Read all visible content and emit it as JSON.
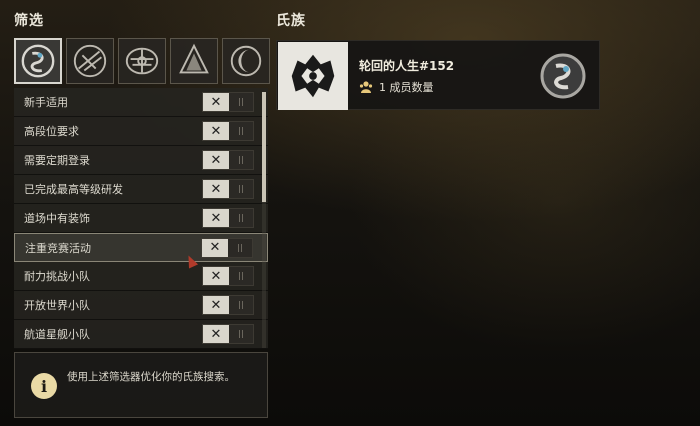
{
  "filter_panel": {
    "title": "筛选",
    "icons": [
      {
        "name": "hunter-class-icon",
        "active": true
      },
      {
        "name": "titan-class-icon",
        "active": false
      },
      {
        "name": "warlock-class-icon",
        "active": false
      },
      {
        "name": "vanguard-class-icon",
        "active": false
      },
      {
        "name": "crescent-class-icon",
        "active": false
      }
    ],
    "rows": [
      {
        "label": "新手适用"
      },
      {
        "label": "高段位要求"
      },
      {
        "label": "需要定期登录"
      },
      {
        "label": "已完成最高等级研发"
      },
      {
        "label": "道场中有装饰"
      },
      {
        "label": "注重竞赛活动"
      },
      {
        "label": "耐力挑战小队"
      },
      {
        "label": "开放世界小队"
      },
      {
        "label": "航道星舰小队"
      }
    ],
    "toggle_state_symbol": "✕",
    "info_text": "使用上述筛选器优化你的氏族搜索。"
  },
  "clan_panel": {
    "title": "氏族",
    "clan": {
      "name": "轮回的人生#152",
      "members": "1 成员数量"
    }
  }
}
